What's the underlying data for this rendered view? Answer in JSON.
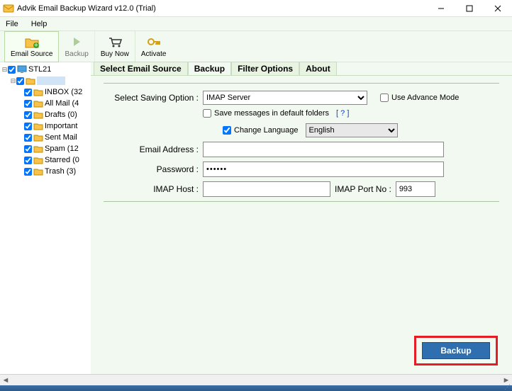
{
  "title": "Advik Email Backup Wizard v12.0 (Trial)",
  "menu": {
    "file": "File",
    "help": "Help"
  },
  "toolbar": {
    "email_source": "Email Source",
    "backup": "Backup",
    "buy_now": "Buy Now",
    "activate": "Activate"
  },
  "tree": {
    "root": "STL21",
    "account": "",
    "folders": [
      "INBOX (32",
      "All Mail (4",
      "Drafts (0)",
      "Important",
      "Sent Mail",
      "Spam (12",
      "Starred (0",
      "Trash (3)"
    ]
  },
  "tabs": {
    "select_source": "Select Email Source",
    "backup": "Backup",
    "filter": "Filter Options",
    "about": "About"
  },
  "form": {
    "saving_option_label": "Select Saving Option  :",
    "saving_option_value": "IMAP Server",
    "advance_mode": "Use Advance Mode",
    "save_default": "Save messages in default folders",
    "help": "[ ? ]",
    "change_language": "Change Language",
    "language_value": "English",
    "email_label": "Email Address  :",
    "email_value": "",
    "password_label": "Password  :",
    "password_value": "••••••",
    "imap_host_label": "IMAP Host  :",
    "imap_host_value": "",
    "imap_port_label": "IMAP Port No  :",
    "imap_port_value": "993",
    "backup_btn": "Backup"
  }
}
